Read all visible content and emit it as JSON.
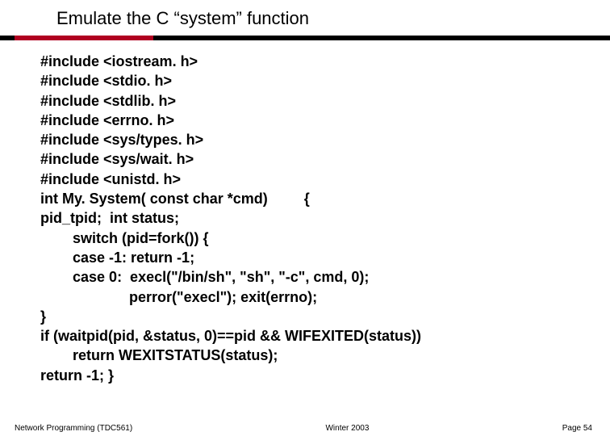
{
  "title": "Emulate the C “system” function",
  "code": {
    "l1": "#include <iostream. h>",
    "l2": "#include <stdio. h>",
    "l3": "#include <stdlib. h>",
    "l4": "#include <errno. h>",
    "l5": "#include <sys/types. h>",
    "l6": "#include <sys/wait. h>",
    "l7": "#include <unistd. h>",
    "l8": "int My. System( const char *cmd)         {",
    "l9": "pid_tpid;  int status;",
    "l10": "        switch (pid=fork()) {",
    "l11": "        case -1: return -1;",
    "l12": "        case 0:  execl(\"/bin/sh\", \"sh\", \"-c\", cmd, 0);",
    "l13": "                      perror(\"execl\"); exit(errno);",
    "l14": "}",
    "l15": "if (waitpid(pid, &status, 0)==pid && WIFEXITED(status))",
    "l16": "        return WEXITSTATUS(status);",
    "l17": "return -1; }"
  },
  "footer": {
    "left": "Network Programming (TDC561)",
    "center": "Winter  2003",
    "right": "Page 54"
  }
}
